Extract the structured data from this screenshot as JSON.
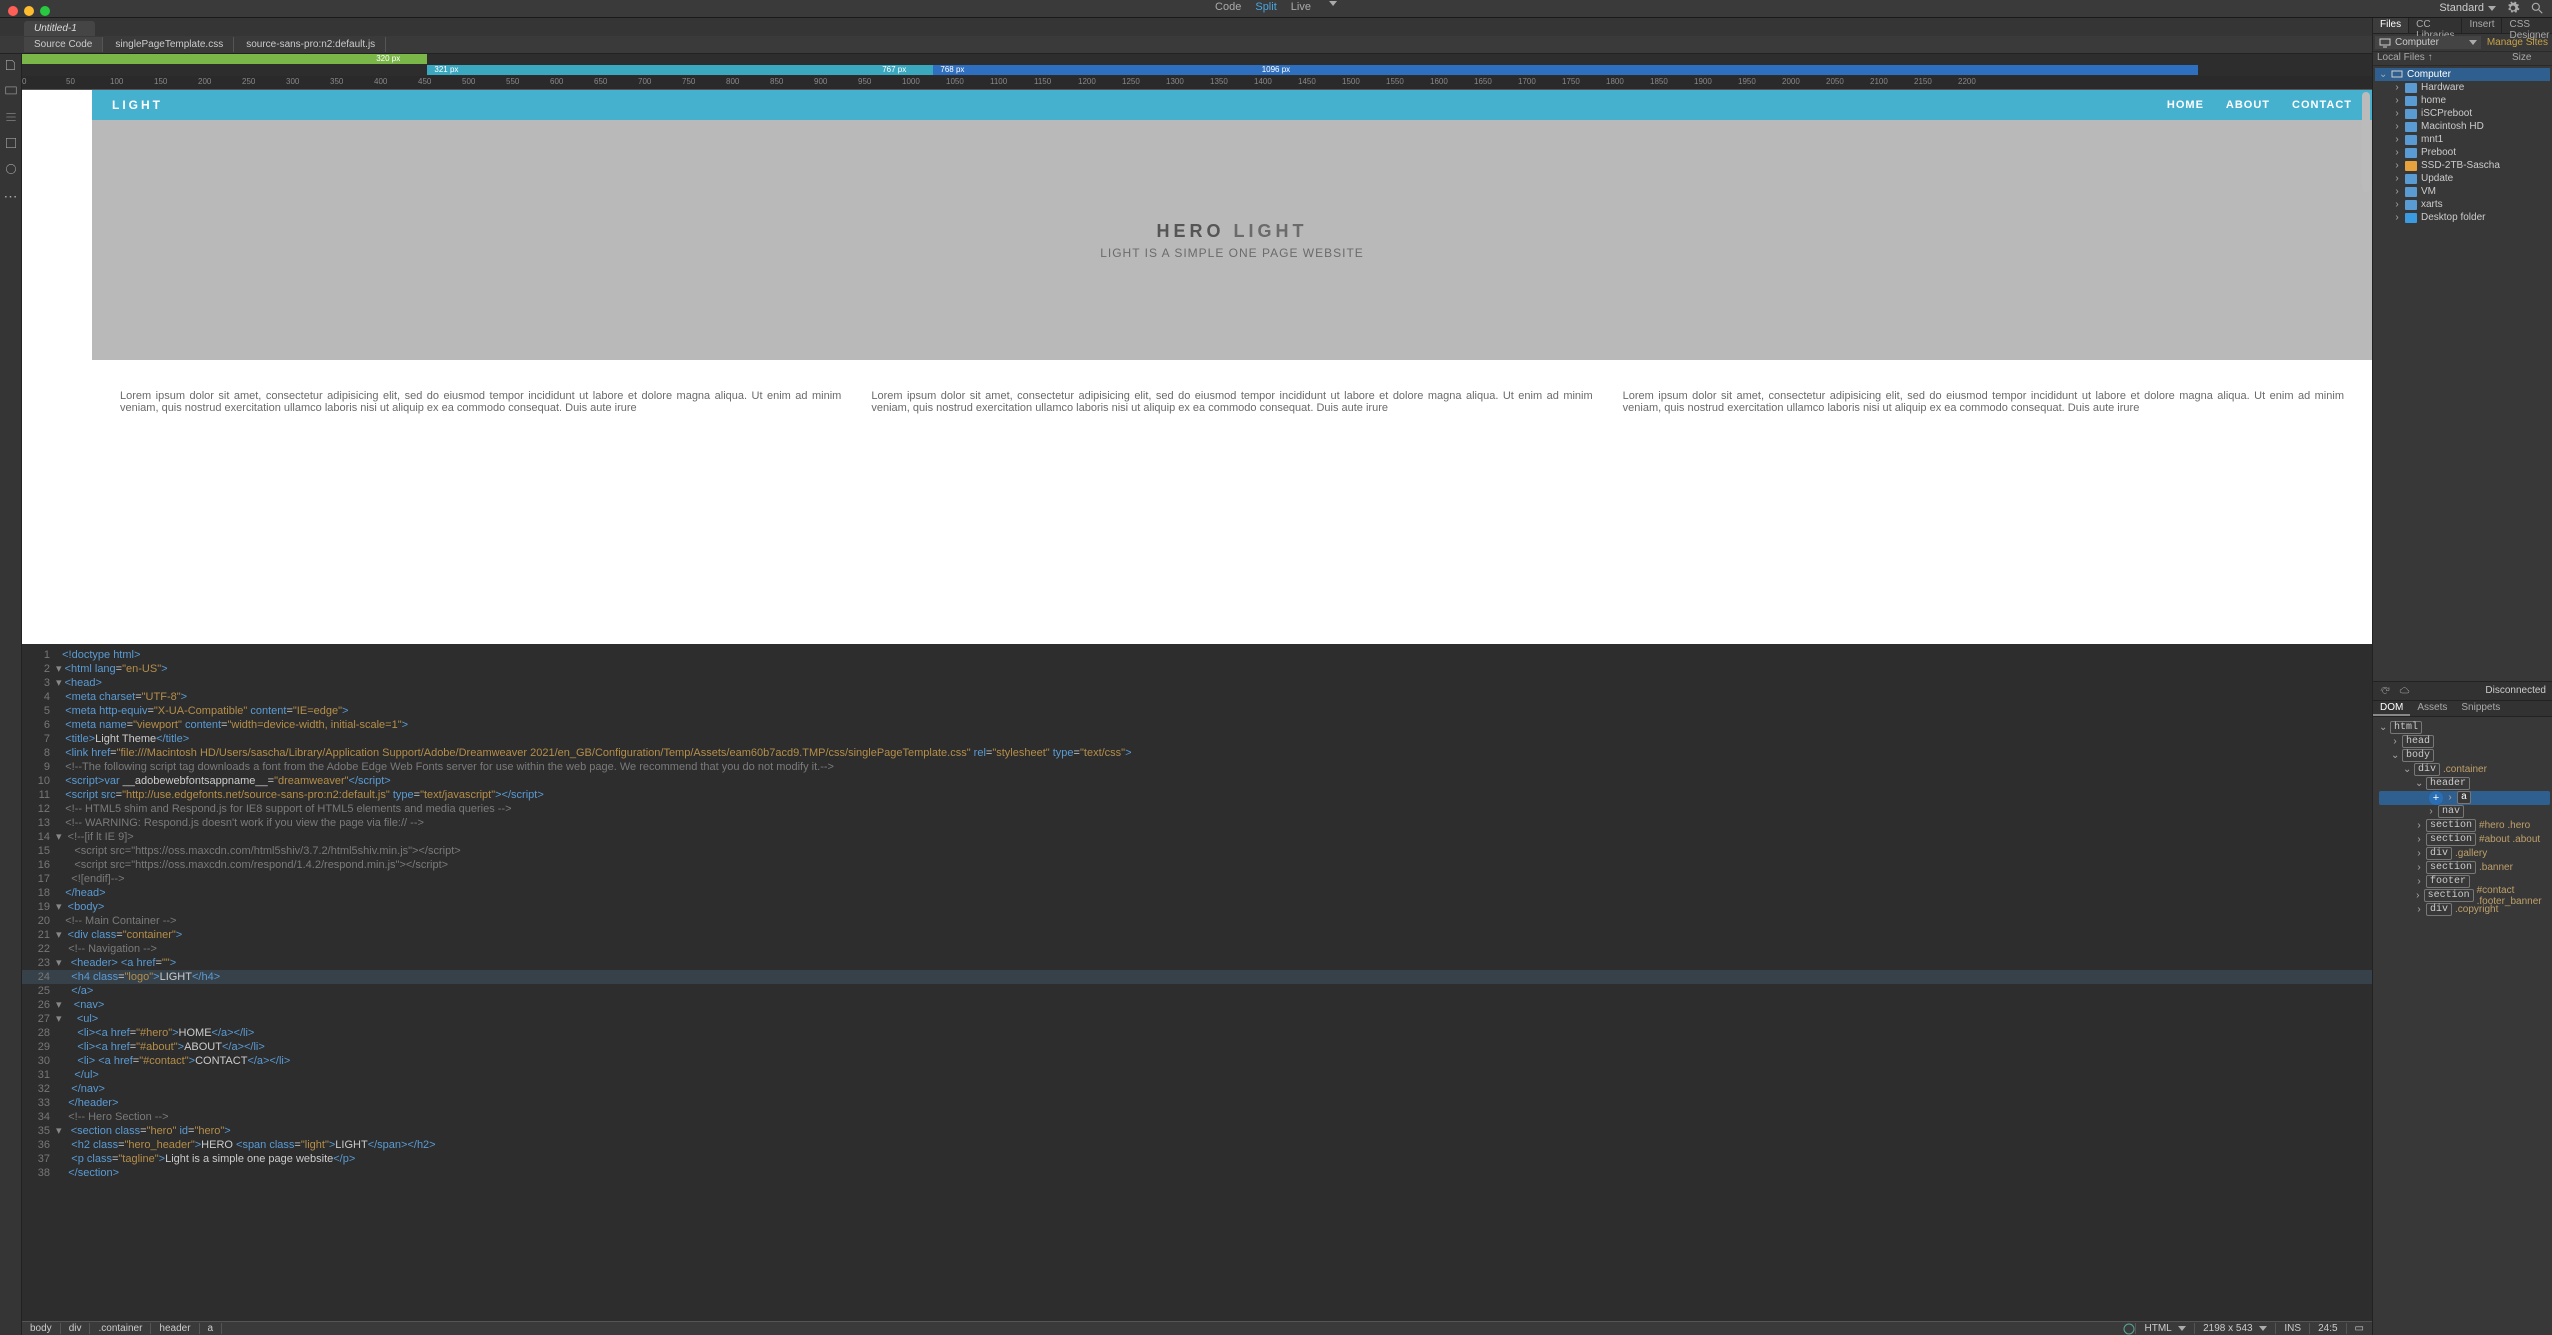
{
  "topbar": {
    "views": [
      "Code",
      "Split",
      "Live"
    ],
    "view_selected": "Split",
    "workspace": "Standard"
  },
  "document_tab": "Untitled-1",
  "source_tabs": [
    "Source Code",
    "singlePageTemplate.css",
    "source-sans-pro:n2:default.js"
  ],
  "source_tab_selected": "Source Code",
  "media_queries": {
    "green_end": "320 px",
    "teal_start": "321 px",
    "teal_end": "767 px",
    "blue_start": "768 px",
    "blue_end": "1096 px"
  },
  "ruler_ticks": [
    "0",
    "50",
    "100",
    "150",
    "200",
    "250",
    "300",
    "350",
    "400",
    "450",
    "500",
    "550",
    "600",
    "650",
    "700",
    "750",
    "800",
    "850",
    "900",
    "950",
    "1000",
    "1050",
    "1100",
    "1150",
    "1200",
    "1250",
    "1300",
    "1350",
    "1400",
    "1450",
    "1500",
    "1550",
    "1600",
    "1650",
    "1700",
    "1750",
    "1800",
    "1850",
    "1900",
    "1950",
    "2000",
    "2050",
    "2100",
    "2150",
    "2200"
  ],
  "live_preview": {
    "brand": "LIGHT",
    "nav": [
      "HOME",
      "ABOUT",
      "CONTACT"
    ],
    "hero_dark": "HERO",
    "hero_light": "LIGHT",
    "tagline": "LIGHT IS A SIMPLE ONE PAGE WEBSITE",
    "paragraph": "Lorem ipsum dolor sit amet, consectetur adipisicing elit, sed do eiusmod tempor incididunt ut labore et dolore magna aliqua. Ut enim ad minim veniam, quis nostrud exercitation ullamco laboris nisi ut aliquip ex ea commodo consequat. Duis aute irure"
  },
  "code": {
    "lines": [
      {
        "n": 1,
        "f": "",
        "h": "<span class='c-tag'>&lt;!doctype html&gt;</span>"
      },
      {
        "n": 2,
        "f": "▾",
        "h": "<span class='c-tag'>&lt;html</span> <span class='c-attr'>lang</span>=<span class='c-str'>\"en-US\"</span><span class='c-tag'>&gt;</span>"
      },
      {
        "n": 3,
        "f": "▾",
        "h": "<span class='c-tag'>&lt;head&gt;</span>"
      },
      {
        "n": 4,
        "f": "",
        "h": " <span class='c-tag'>&lt;meta</span> <span class='c-attr'>charset</span>=<span class='c-str'>\"UTF-8\"</span><span class='c-tag'>&gt;</span>"
      },
      {
        "n": 5,
        "f": "",
        "h": " <span class='c-tag'>&lt;meta</span> <span class='c-attr'>http-equiv</span>=<span class='c-str'>\"X-UA-Compatible\"</span> <span class='c-attr'>content</span>=<span class='c-str'>\"IE=edge\"</span><span class='c-tag'>&gt;</span>"
      },
      {
        "n": 6,
        "f": "",
        "h": " <span class='c-tag'>&lt;meta</span> <span class='c-attr'>name</span>=<span class='c-str'>\"viewport\"</span> <span class='c-attr'>content</span>=<span class='c-str'>\"width=device-width, initial-scale=1\"</span><span class='c-tag'>&gt;</span>"
      },
      {
        "n": 7,
        "f": "",
        "h": " <span class='c-tag'>&lt;title&gt;</span><span class='c-txt'>Light Theme</span><span class='c-tag'>&lt;/title&gt;</span>"
      },
      {
        "n": 8,
        "f": "",
        "h": " <span class='c-tag'>&lt;link</span> <span class='c-attr'>href</span>=<span class='c-str'>\"file:///Macintosh HD/Users/sascha/Library/Application Support/Adobe/Dreamweaver 2021/en_GB/Configuration/Temp/Assets/eam60b7acd9.TMP/css/singlePageTemplate.css\"</span> <span class='c-attr'>rel</span>=<span class='c-str'>\"stylesheet\"</span> <span class='c-attr'>type</span>=<span class='c-str'>\"text/css\"</span><span class='c-tag'>&gt;</span>"
      },
      {
        "n": 9,
        "f": "",
        "h": " <span class='c-com'>&lt;!--The following script tag downloads a font from the Adobe Edge Web Fonts server for use within the web page. We recommend that you do not modify it.--&gt;</span>"
      },
      {
        "n": 10,
        "f": "",
        "h": " <span class='c-tag'>&lt;script&gt;</span><span class='c-attr'>var</span> <span class='c-txt'>__adobewebfontsappname__=</span><span class='c-str'>\"dreamweaver\"</span><span class='c-tag'>&lt;/script&gt;</span>"
      },
      {
        "n": 11,
        "f": "",
        "h": " <span class='c-tag'>&lt;script</span> <span class='c-attr'>src</span>=<span class='c-str'>\"http://use.edgefonts.net/source-sans-pro:n2:default.js\"</span> <span class='c-attr'>type</span>=<span class='c-str'>\"text/javascript\"</span><span class='c-tag'>&gt;&lt;/script&gt;</span>"
      },
      {
        "n": 12,
        "f": "",
        "h": " <span class='c-com'>&lt;!-- HTML5 shim and Respond.js for IE8 support of HTML5 elements and media queries --&gt;</span>"
      },
      {
        "n": 13,
        "f": "",
        "h": " <span class='c-com'>&lt;!-- WARNING: Respond.js doesn't work if you view the page via file:// --&gt;</span>"
      },
      {
        "n": 14,
        "f": "▾",
        "h": " <span class='c-com'>&lt;!--[if lt IE 9]&gt;</span>"
      },
      {
        "n": 15,
        "f": "",
        "h": "    <span class='c-com'>&lt;script src=\"https://oss.maxcdn.com/html5shiv/3.7.2/html5shiv.min.js\"&gt;&lt;/script&gt;</span>"
      },
      {
        "n": 16,
        "f": "",
        "h": "    <span class='c-com'>&lt;script src=\"https://oss.maxcdn.com/respond/1.4.2/respond.min.js\"&gt;&lt;/script&gt;</span>"
      },
      {
        "n": 17,
        "f": "",
        "h": "   <span class='c-com'>&lt;![endif]--&gt;</span>"
      },
      {
        "n": 18,
        "f": "",
        "h": " <span class='c-tag'>&lt;/head&gt;</span>"
      },
      {
        "n": 19,
        "f": "▾",
        "h": " <span class='c-tag'>&lt;body&gt;</span>"
      },
      {
        "n": 20,
        "f": "",
        "h": " <span class='c-com'>&lt;!-- Main Container --&gt;</span>"
      },
      {
        "n": 21,
        "f": "▾",
        "h": " <span class='c-tag'>&lt;div</span> <span class='c-attr'>class</span>=<span class='c-str'>\"container\"</span><span class='c-tag'>&gt;</span>"
      },
      {
        "n": 22,
        "f": "",
        "h": "  <span class='c-com'>&lt;!-- Navigation --&gt;</span>"
      },
      {
        "n": 23,
        "f": "▾",
        "h": "  <span class='c-tag'>&lt;header&gt;</span> <span class='c-tag'>&lt;a</span> <span class='c-attr'>href</span>=<span class='c-str'>\"\"</span><span class='c-tag'>&gt;</span>"
      },
      {
        "n": 24,
        "f": "",
        "hl": true,
        "h": "   <span class='c-tag'>&lt;h4</span> <span class='c-attr'>class</span>=<span class='c-str'>\"logo\"</span><span class='c-tag'>&gt;</span><span class='c-txt'>LIGHT</span><span class='c-tag'>&lt;/h4&gt;</span>"
      },
      {
        "n": 25,
        "f": "",
        "h": "   <span class='c-tag'>&lt;/a&gt;</span>"
      },
      {
        "n": 26,
        "f": "▾",
        "h": "   <span class='c-tag'>&lt;nav&gt;</span>"
      },
      {
        "n": 27,
        "f": "▾",
        "h": "    <span class='c-tag'>&lt;ul&gt;</span>"
      },
      {
        "n": 28,
        "f": "",
        "h": "     <span class='c-tag'>&lt;li&gt;&lt;a</span> <span class='c-attr'>href</span>=<span class='c-str'>\"#hero\"</span><span class='c-tag'>&gt;</span><span class='c-txt'>HOME</span><span class='c-tag'>&lt;/a&gt;&lt;/li&gt;</span>"
      },
      {
        "n": 29,
        "f": "",
        "h": "     <span class='c-tag'>&lt;li&gt;&lt;a</span> <span class='c-attr'>href</span>=<span class='c-str'>\"#about\"</span><span class='c-tag'>&gt;</span><span class='c-txt'>ABOUT</span><span class='c-tag'>&lt;/a&gt;&lt;/li&gt;</span>"
      },
      {
        "n": 30,
        "f": "",
        "h": "     <span class='c-tag'>&lt;li&gt;</span> <span class='c-tag'>&lt;a</span> <span class='c-attr'>href</span>=<span class='c-str'>\"#contact\"</span><span class='c-tag'>&gt;</span><span class='c-txt'>CONTACT</span><span class='c-tag'>&lt;/a&gt;&lt;/li&gt;</span>"
      },
      {
        "n": 31,
        "f": "",
        "h": "    <span class='c-tag'>&lt;/ul&gt;</span>"
      },
      {
        "n": 32,
        "f": "",
        "h": "   <span class='c-tag'>&lt;/nav&gt;</span>"
      },
      {
        "n": 33,
        "f": "",
        "h": "  <span class='c-tag'>&lt;/header&gt;</span>"
      },
      {
        "n": 34,
        "f": "",
        "h": "  <span class='c-com'>&lt;!-- Hero Section --&gt;</span>"
      },
      {
        "n": 35,
        "f": "▾",
        "h": "  <span class='c-tag'>&lt;section</span> <span class='c-attr'>class</span>=<span class='c-str'>\"hero\"</span> <span class='c-attr'>id</span>=<span class='c-str'>\"hero\"</span><span class='c-tag'>&gt;</span>"
      },
      {
        "n": 36,
        "f": "",
        "h": "   <span class='c-tag'>&lt;h2</span> <span class='c-attr'>class</span>=<span class='c-str'>\"hero_header\"</span><span class='c-tag'>&gt;</span><span class='c-txt'>HERO </span><span class='c-tag'>&lt;span</span> <span class='c-attr'>class</span>=<span class='c-str'>\"light\"</span><span class='c-tag'>&gt;</span><span class='c-txt'>LIGHT</span><span class='c-tag'>&lt;/span&gt;&lt;/h2&gt;</span>"
      },
      {
        "n": 37,
        "f": "",
        "h": "   <span class='c-tag'>&lt;p</span> <span class='c-attr'>class</span>=<span class='c-str'>\"tagline\"</span><span class='c-tag'>&gt;</span><span class='c-txt'>Light is a simple one page website</span><span class='c-tag'>&lt;/p&gt;</span>"
      },
      {
        "n": 38,
        "f": "",
        "h": "  <span class='c-tag'>&lt;/section&gt;</span>"
      }
    ]
  },
  "status": {
    "crumbs": [
      "body",
      "div",
      ".container",
      "header",
      "a"
    ],
    "lang": "HTML",
    "size": "2198 x 543",
    "ins": "INS",
    "pos": "24:5"
  },
  "files_panel": {
    "tabs": [
      "Files",
      "CC Libraries",
      "Insert",
      "CSS Designer"
    ],
    "selected_tab": "Files",
    "site_selector": "Computer",
    "manage_link": "Manage Sites",
    "columns": [
      "Local Files ↑",
      "Size"
    ],
    "tree": [
      {
        "d": 0,
        "exp": true,
        "kind": "computer",
        "label": "Computer",
        "sel": true
      },
      {
        "d": 1,
        "exp": false,
        "kind": "folder",
        "label": "Hardware"
      },
      {
        "d": 1,
        "exp": false,
        "kind": "folder",
        "label": "home"
      },
      {
        "d": 1,
        "exp": false,
        "kind": "folder",
        "label": "iSCPreboot"
      },
      {
        "d": 1,
        "exp": false,
        "kind": "folder",
        "label": "Macintosh HD"
      },
      {
        "d": 1,
        "exp": false,
        "kind": "folder",
        "label": "mnt1"
      },
      {
        "d": 1,
        "exp": false,
        "kind": "folder",
        "label": "Preboot"
      },
      {
        "d": 1,
        "exp": false,
        "kind": "folder-yel",
        "label": "SSD-2TB-Sascha"
      },
      {
        "d": 1,
        "exp": false,
        "kind": "folder",
        "label": "Update"
      },
      {
        "d": 1,
        "exp": false,
        "kind": "folder",
        "label": "VM"
      },
      {
        "d": 1,
        "exp": false,
        "kind": "folder",
        "label": "xarts"
      },
      {
        "d": 1,
        "exp": false,
        "kind": "desktop",
        "label": "Desktop folder"
      }
    ]
  },
  "connection_status": "Disconnected",
  "dom_panel": {
    "tabs": [
      "DOM",
      "Assets",
      "Snippets"
    ],
    "selected": "DOM",
    "tree": [
      {
        "d": 0,
        "exp": true,
        "tag": "html"
      },
      {
        "d": 1,
        "exp": false,
        "tag": "head"
      },
      {
        "d": 1,
        "exp": true,
        "tag": "body"
      },
      {
        "d": 2,
        "exp": true,
        "tag": "div",
        "cls": ".container"
      },
      {
        "d": 3,
        "exp": true,
        "tag": "header"
      },
      {
        "d": 4,
        "exp": false,
        "tag": "a",
        "sel": true
      },
      {
        "d": 4,
        "exp": false,
        "tag": "nav"
      },
      {
        "d": 3,
        "exp": false,
        "tag": "section",
        "cls": "#hero .hero"
      },
      {
        "d": 3,
        "exp": false,
        "tag": "section",
        "cls": "#about .about"
      },
      {
        "d": 3,
        "exp": false,
        "tag": "div",
        "cls": ".gallery"
      },
      {
        "d": 3,
        "exp": false,
        "tag": "section",
        "cls": ".banner"
      },
      {
        "d": 3,
        "exp": false,
        "tag": "footer"
      },
      {
        "d": 3,
        "exp": false,
        "tag": "section",
        "cls": "#contact .footer_banner"
      },
      {
        "d": 3,
        "exp": false,
        "tag": "div",
        "cls": ".copyright"
      }
    ]
  }
}
